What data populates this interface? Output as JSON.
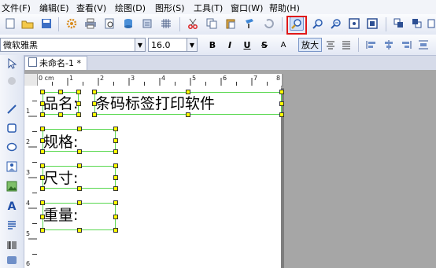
{
  "menu": [
    "文件(F)",
    "编辑(E)",
    "查看(V)",
    "绘图(D)",
    "图形(S)",
    "工具(T)",
    "窗口(W)",
    "帮助(H)"
  ],
  "format": {
    "font_name": "微软雅黑",
    "font_size": "16.0",
    "bold": "B",
    "italic": "I",
    "underline": "U",
    "strike": "S",
    "text_sep": "A"
  },
  "zoom_tooltip": "放大",
  "doc_tab": "未命名-1 *",
  "ruler": {
    "h_units": [
      "0 cm",
      "1",
      "2",
      "3",
      "4",
      "5",
      "6",
      "7",
      "8"
    ],
    "v_units": [
      "1",
      "2",
      "3",
      "4",
      "5",
      "6"
    ]
  },
  "canvas": {
    "label1": "品名:",
    "label1_value": "条码标签打印软件",
    "label2": "规格:",
    "label3": "尺寸:",
    "label4": "重量:"
  },
  "colors": {
    "handle": "#ffff00",
    "frame": "#58d84e",
    "highlight": "#e01818"
  }
}
